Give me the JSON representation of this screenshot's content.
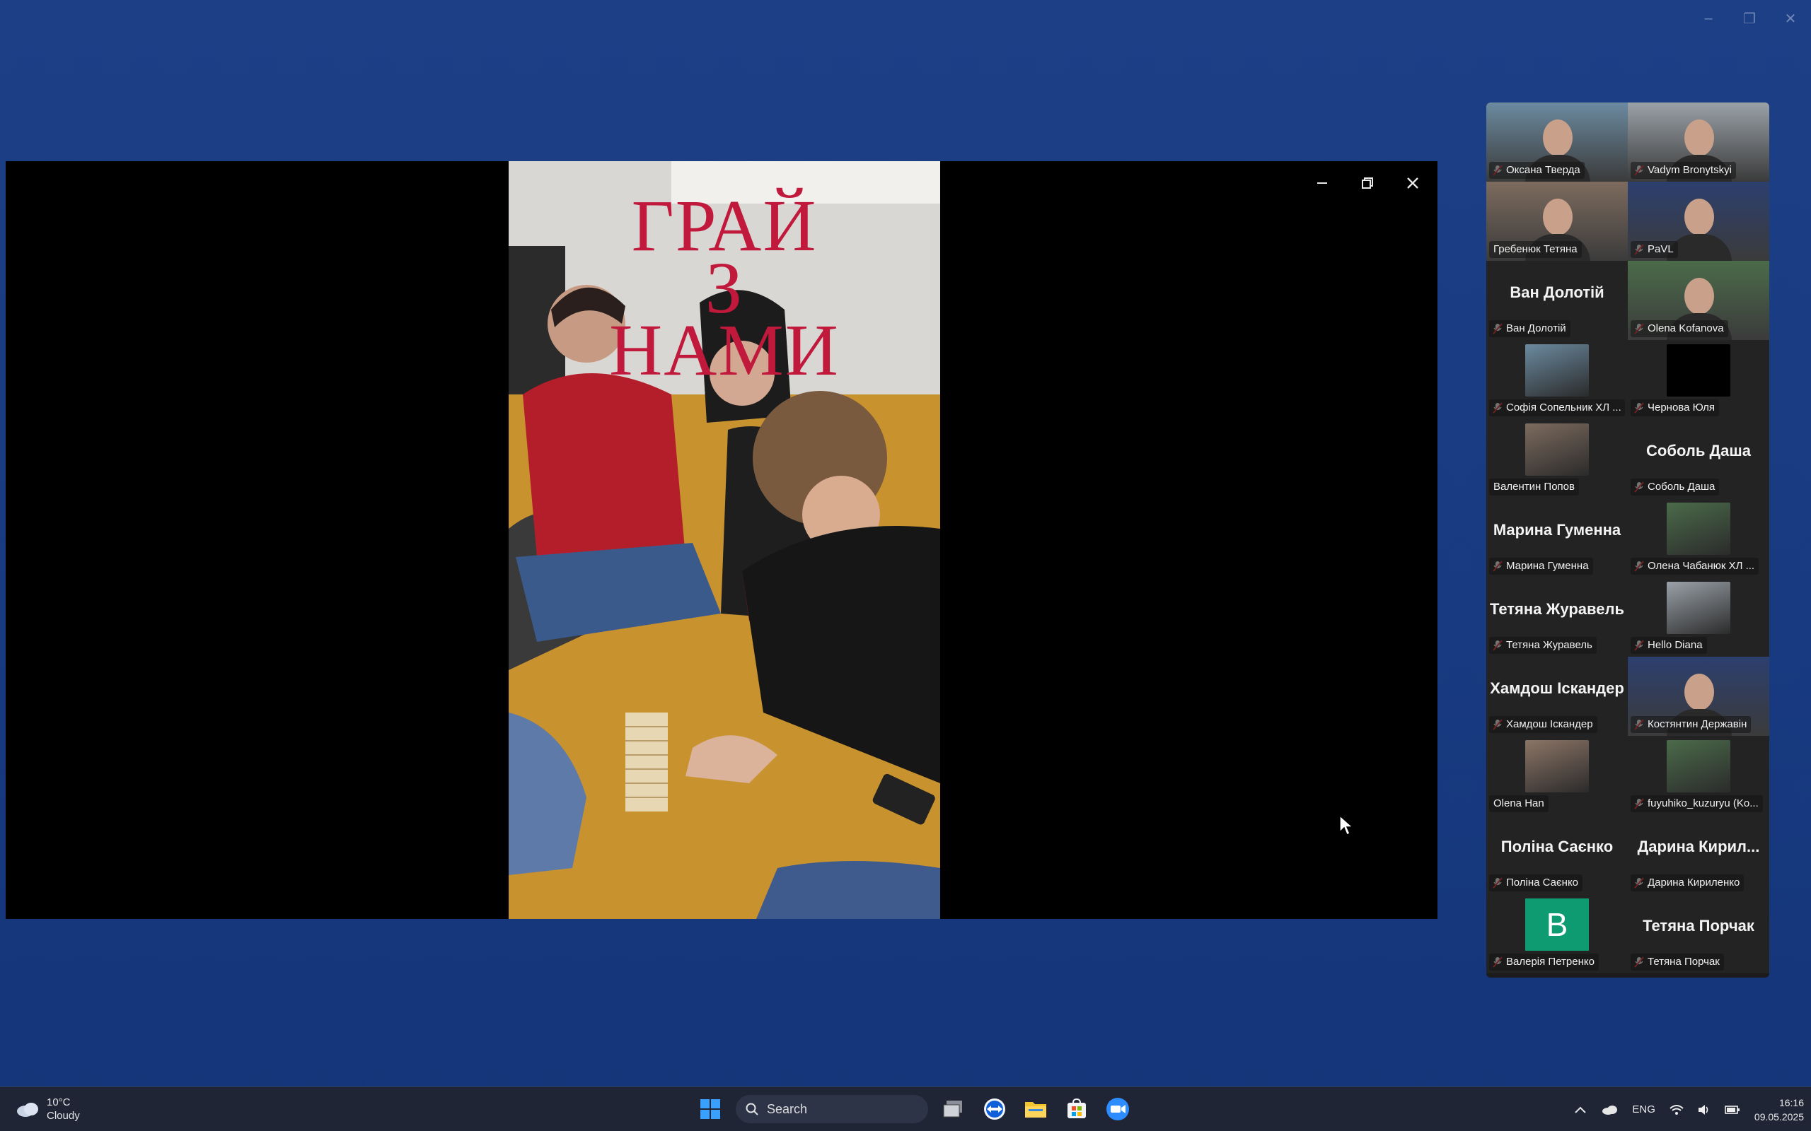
{
  "window_controls": {
    "minimize": "–",
    "restore": "❐",
    "close": "✕"
  },
  "share": {
    "controls": {
      "minimize": "minimize",
      "restore": "restore",
      "close": "close"
    },
    "video_title": [
      "ГРАЙ",
      "З",
      "НАМИ"
    ]
  },
  "gallery": {
    "tiles": [
      {
        "label": "Оксана Тверда",
        "kind": "video",
        "muted": true
      },
      {
        "label": "Vadym Bronytskyi",
        "kind": "video",
        "muted": true
      },
      {
        "label": "Гребенюк Тетяна",
        "kind": "video",
        "muted": false,
        "active": true
      },
      {
        "label": "PaVL",
        "kind": "video",
        "muted": true
      },
      {
        "label": "Ван Долотій",
        "big_name": "Ван Долотій",
        "kind": "name",
        "muted": true
      },
      {
        "label": "Olena Kofanova",
        "kind": "video",
        "muted": true
      },
      {
        "label": "Софія Сопельник ХЛ ...",
        "kind": "photo",
        "muted": true
      },
      {
        "label": "Чернова Юля",
        "kind": "photo-dark",
        "muted": true
      },
      {
        "label": "Валентин Попов",
        "kind": "photo",
        "muted": false
      },
      {
        "label": "Соболь Даша",
        "big_name": "Соболь Даша",
        "kind": "name",
        "muted": true
      },
      {
        "label": "Марина Гуменна",
        "big_name": "Марина Гуменна",
        "kind": "name",
        "muted": true
      },
      {
        "label": "Олена Чабанюк ХЛ ...",
        "kind": "photo",
        "muted": true
      },
      {
        "label": "Тетяна Журавель",
        "big_name": "Тетяна Журавель",
        "kind": "name",
        "muted": true
      },
      {
        "label": "Hello Diana",
        "kind": "photo",
        "muted": true
      },
      {
        "label": "Хамдош Іскандер",
        "big_name": "Хамдош Іскандер",
        "kind": "name",
        "muted": true
      },
      {
        "label": "Костянтин Державін",
        "kind": "video",
        "muted": true
      },
      {
        "label": "Olena Han",
        "kind": "photo",
        "muted": false
      },
      {
        "label": "fuyuhiko_kuzuryu (Ko...",
        "kind": "photo",
        "muted": true
      },
      {
        "label": "Поліна Саєнко",
        "big_name": "Поліна Саєнко",
        "kind": "name",
        "muted": true
      },
      {
        "label": "Дарина Кириленко",
        "big_name": "Дарина Кирил...",
        "kind": "name",
        "muted": true
      },
      {
        "label": "Валерія Петренко",
        "kind": "avatar",
        "avatar_letter": "B",
        "muted": true
      },
      {
        "label": "Тетяна Порчак",
        "big_name": "Тетяна Порчак",
        "kind": "name",
        "muted": true
      }
    ]
  },
  "taskbar": {
    "weather": {
      "temp": "10°C",
      "condition": "Cloudy"
    },
    "search_label": "Search",
    "apps": [
      "start",
      "search",
      "task-view",
      "teamviewer",
      "file-explorer",
      "microsoft-store",
      "zoom"
    ],
    "tray": {
      "language": "ENG",
      "time": "16:16",
      "date": "09.05.2025"
    }
  },
  "colors": {
    "desktop": "#1d3f86",
    "title_red": "#c0193b",
    "active_outline": "#31d27a",
    "taskbar": "#1f2535"
  }
}
